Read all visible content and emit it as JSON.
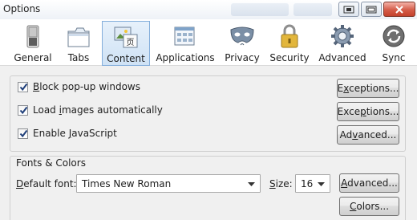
{
  "window": {
    "title": "Options"
  },
  "toolbar": {
    "tabs": [
      {
        "label": "General",
        "icon": "switch-icon"
      },
      {
        "label": "Tabs",
        "icon": "tabs-icon"
      },
      {
        "label": "Content",
        "icon": "content-icon",
        "selected": true
      },
      {
        "label": "Applications",
        "icon": "applications-icon"
      },
      {
        "label": "Privacy",
        "icon": "mask-icon"
      },
      {
        "label": "Security",
        "icon": "padlock-icon"
      },
      {
        "label": "Advanced",
        "icon": "gear-icon"
      },
      {
        "label": "Sync",
        "icon": "sync-icon"
      }
    ]
  },
  "content": {
    "block_popups": {
      "label": "Block pop-up windows",
      "checked": true,
      "button": "Exceptions..."
    },
    "load_images": {
      "label": "Load images automatically",
      "checked": true,
      "button": "Exceptions..."
    },
    "enable_js": {
      "label": "Enable JavaScript",
      "checked": true,
      "button": "Advanced..."
    }
  },
  "fonts": {
    "legend": "Fonts & Colors",
    "default_font_label": "Default font:",
    "default_font_value": "Times New Roman",
    "size_label": "Size:",
    "size_value": "16",
    "advanced_button": "Advanced...",
    "colors_button": "Colors..."
  }
}
